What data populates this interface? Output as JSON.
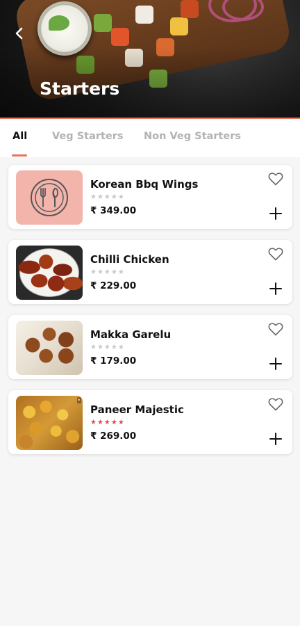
{
  "header": {
    "title": "Starters",
    "accent_color": "#e8725a"
  },
  "tabs": [
    {
      "label": "All",
      "active": true
    },
    {
      "label": "Veg Starters",
      "active": false
    },
    {
      "label": "Non Veg Starters",
      "active": false
    }
  ],
  "items": [
    {
      "name": "Korean Bbq Wings",
      "stars": "★★★★★",
      "rating": 0,
      "price": "₹ 349.00",
      "image": "placeholder-cutlery-icon"
    },
    {
      "name": "Chilli Chicken",
      "stars": "★★★★★",
      "rating": 0,
      "price": "₹ 229.00",
      "image": "chilli-chicken-photo"
    },
    {
      "name": "Makka Garelu",
      "stars": "★★★★★",
      "rating": 0,
      "price": "₹ 179.00",
      "image": "makka-garelu-photo"
    },
    {
      "name": "Paneer Majestic",
      "stars": "★★★★★",
      "rating": 5,
      "price": "₹ 269.00",
      "image": "paneer-majestic-photo"
    }
  ],
  "icons": {
    "back": "chevron-left-icon",
    "favorite": "heart-outline-icon",
    "add": "plus-icon"
  },
  "colors": {
    "rated_star": "#e84a4a",
    "unrated_star": "#c8c8c8",
    "placeholder_bg": "#f3b4ab"
  }
}
